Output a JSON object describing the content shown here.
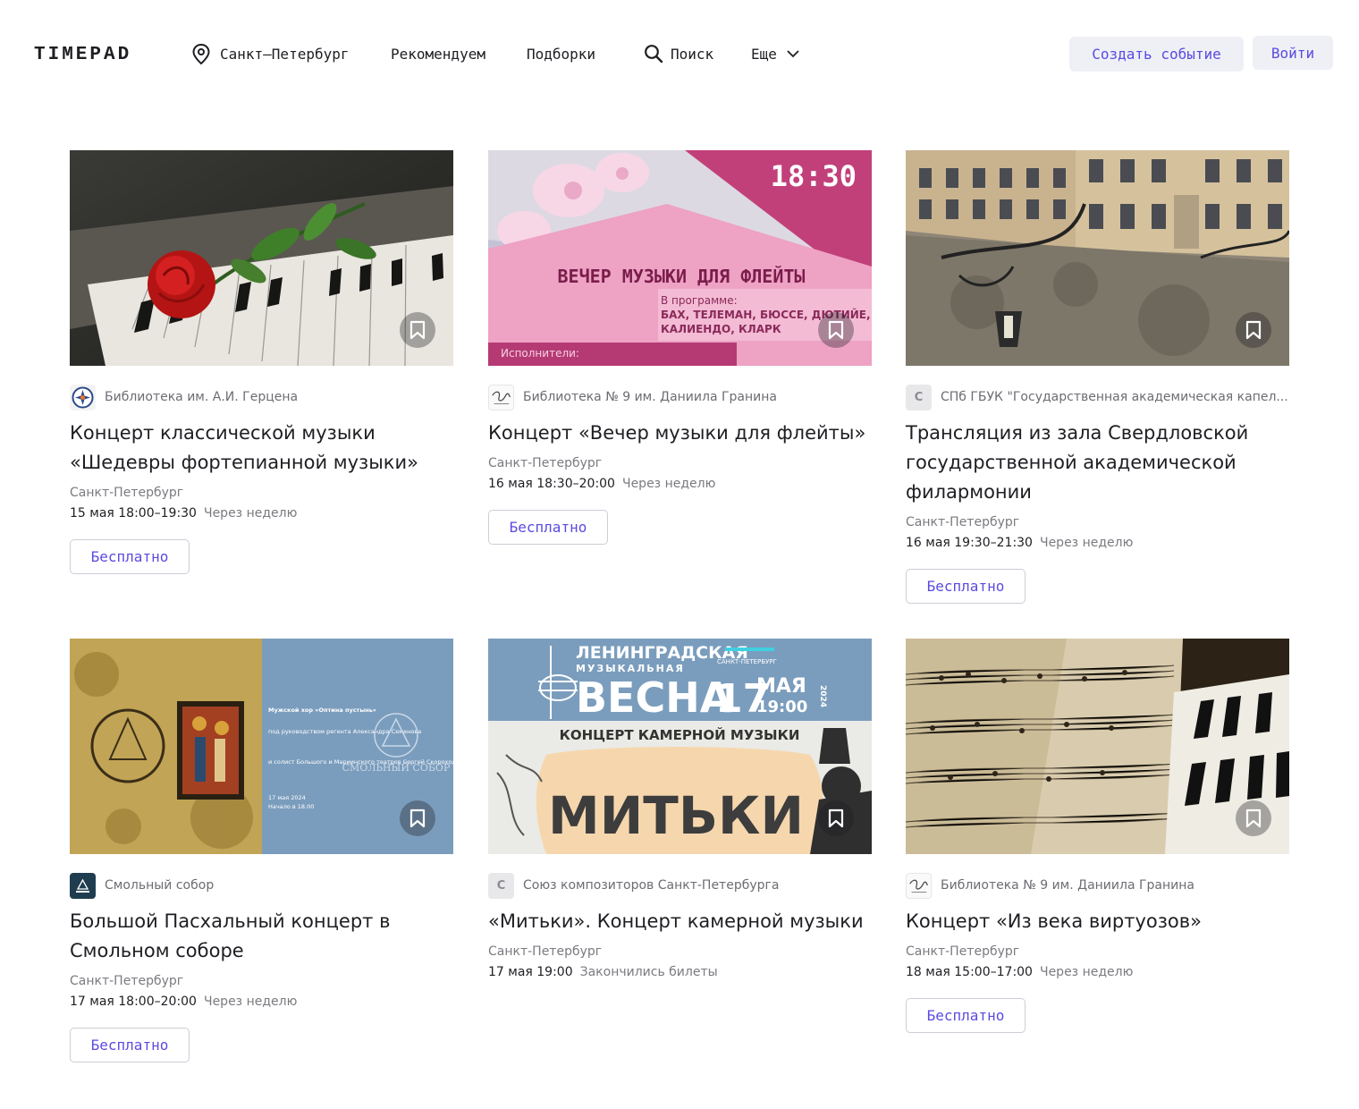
{
  "header": {
    "logo": "TIMEPAD",
    "city": "Санкт–Петербург",
    "nav_recommend": "Рекомендуем",
    "nav_selections": "Подборки",
    "search": "Поиск",
    "more": "Еще",
    "create_event": "Создать событие",
    "login": "Войти"
  },
  "colors": {
    "accent": "#5b4ae0",
    "button_bg": "#eef0f6",
    "text": "#1e1e23",
    "muted": "#7a7a80"
  },
  "events": [
    {
      "organizer": "Библиотека им. А.И. Герцена",
      "title": "Концерт классической музыки «Шедевры фортепианной музыки»",
      "city": "Санкт-Петербург",
      "datetime": "15 мая 18:00–19:30",
      "relative": "Через неделю",
      "price": "Бесплатно"
    },
    {
      "organizer": "Библиотека № 9 им. Даниила Гранина",
      "title": "Концерт «Вечер музыки для флейты»",
      "city": "Санкт-Петербург",
      "datetime": "16 мая 18:30–20:00",
      "relative": "Через неделю",
      "price": "Бесплатно",
      "poster": {
        "time": "18:30",
        "heading": "ВЕЧЕР МУЗЫКИ ДЛЯ ФЛЕЙТЫ",
        "program_1": "В программе:",
        "program_2": "БАХ, ТЕЛЕМАН, БЮССЕ, ДЮТИЙЕ,",
        "program_3": "КАЛИЕНДО, КЛАРК",
        "performers": "Исполнители:"
      }
    },
    {
      "organizer": "СПб ГБУК \"Государственная академическая капел...",
      "organizer_initial": "С",
      "title": "Трансляция из зала Свердловской государственной академической филармонии",
      "city": "Санкт-Петербург",
      "datetime": "16 мая 19:30–21:30",
      "relative": "Через неделю",
      "price": "Бесплатно"
    },
    {
      "organizer": "Смольный собор",
      "title": "Большой Пасхальный концерт в Смольном соборе",
      "city": "Санкт-Петербург",
      "datetime": "17 мая 18:00–20:00",
      "relative": "Через неделю",
      "price": "Бесплатно",
      "poster": {
        "choir": "Мужской хор «Оптина пустынь»",
        "director": "под руководством регента Александра Семенова",
        "soloist": "и солист Большого и Мариинского театров Сергей Скороходов",
        "date": "17 мая 2024",
        "start": "Начало в 18.00",
        "place": "СМОЛЬНЫЙ СОБОР"
      }
    },
    {
      "organizer": "Союз композиторов Санкт-Петербурга",
      "organizer_initial": "С",
      "title": "«Митьки». Концерт камерной музыки",
      "city": "Санкт-Петербург",
      "datetime": "17 мая 19:00",
      "relative": "Закончились билеты",
      "poster": {
        "line1": "ЛЕНИНГРАДСКАЯ",
        "line2": "МУЗЫКАЛЬНАЯ",
        "line3": "ВЕСНА",
        "day": "17",
        "month": "МАЯ",
        "time": "19:00",
        "year": "2024",
        "city": "САНКТ-ПЕТЕРБУРГ",
        "subtitle": "КОНЦЕРТ КАМЕРНОЙ МУЗЫКИ",
        "name": "МИТЬКИ"
      }
    },
    {
      "organizer": "Библиотека № 9 им. Даниила Гранина",
      "title": "Концерт «Из века виртуозов»",
      "city": "Санкт-Петербург",
      "datetime": "18 мая 15:00–17:00",
      "relative": "Через неделю",
      "price": "Бесплатно"
    }
  ]
}
